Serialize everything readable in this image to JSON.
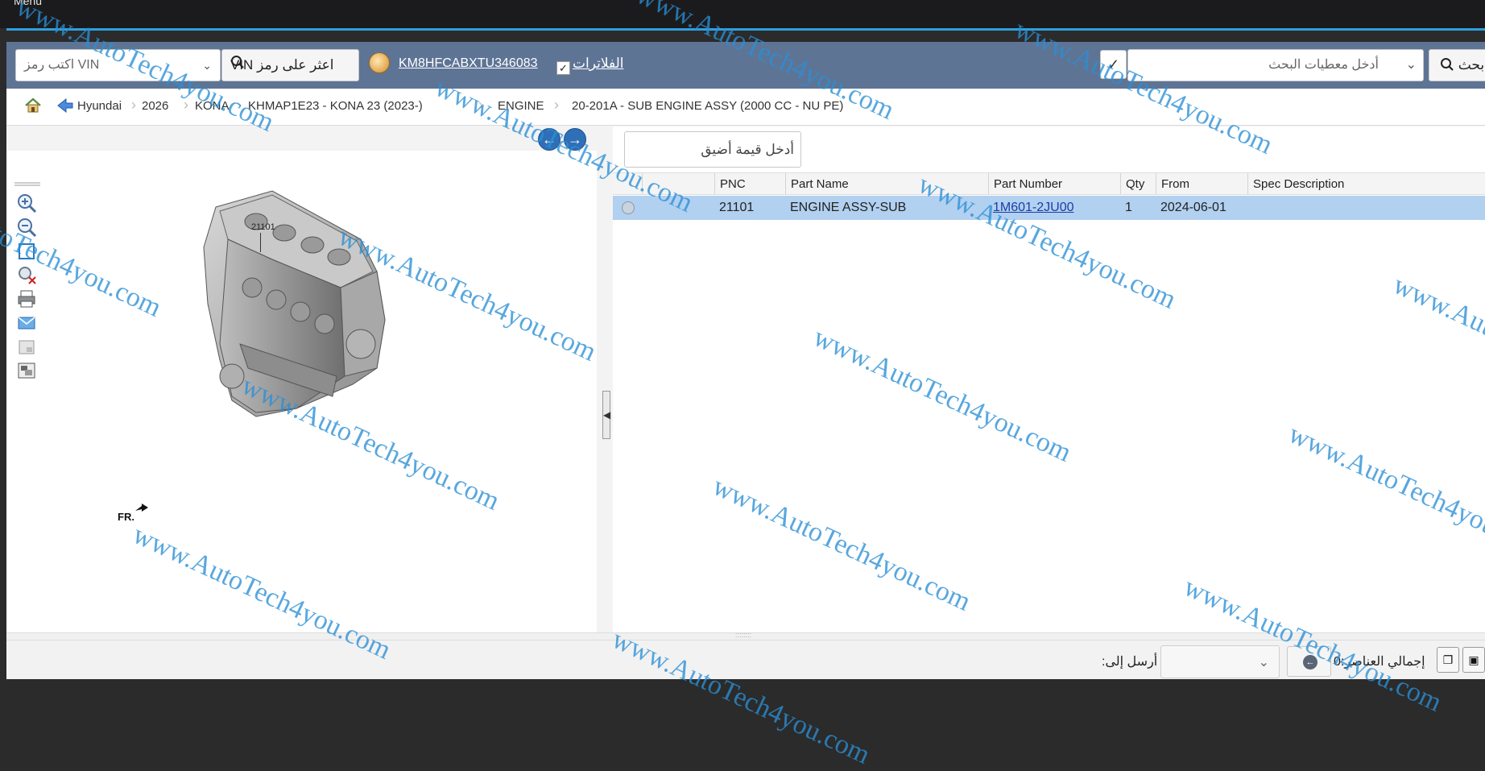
{
  "window": {
    "menu_label": "Menu"
  },
  "toolbar": {
    "vin_placeholder": "اكتب رمز VIN",
    "find_vin_label": "اعثر على رمز VIN",
    "vin_value": "KM8HFCABXTU346083",
    "filters_label": "الفلاترات",
    "filters_checked": true,
    "search_placeholder": "أدخل معطيات البحث",
    "search_label": "ابحث"
  },
  "breadcrumb": [
    "Hyundai",
    "2026",
    "KONA",
    "KHMAP1E23 - KONA 23 (2023-)",
    "ENGINE",
    "20-201A - SUB ENGINE ASSY (2000 CC - NU PE)"
  ],
  "diagram": {
    "callout": "21101",
    "direction_label": "FR.",
    "tools": [
      "zoom-in-icon",
      "zoom-out-icon",
      "fit-icon",
      "reset-zoom-icon",
      "print-icon",
      "email-icon",
      "image-icon",
      "export-icon"
    ]
  },
  "parts": {
    "filter_placeholder": "أدخل قيمة أضيق",
    "columns": [
      "PNC",
      "Part Name",
      "Part Number",
      "Qty",
      "From",
      "Spec Description"
    ],
    "rows": [
      {
        "pnc": "21101",
        "part_name": "ENGINE ASSY-SUB",
        "part_number": "1M601-2JU00",
        "qty": "1",
        "from": "2024-06-01",
        "spec": ""
      }
    ]
  },
  "status": {
    "send_to_label": "أرسل إلى:",
    "total_label": "إجمالي العناصر:0"
  },
  "watermark": "www.AutoTech4you.com",
  "colors": {
    "toolbar": "#5e7495",
    "accent": "#2ea0dc",
    "selected_row": "#b2d0f0",
    "watermark": "#2a8fd6"
  }
}
